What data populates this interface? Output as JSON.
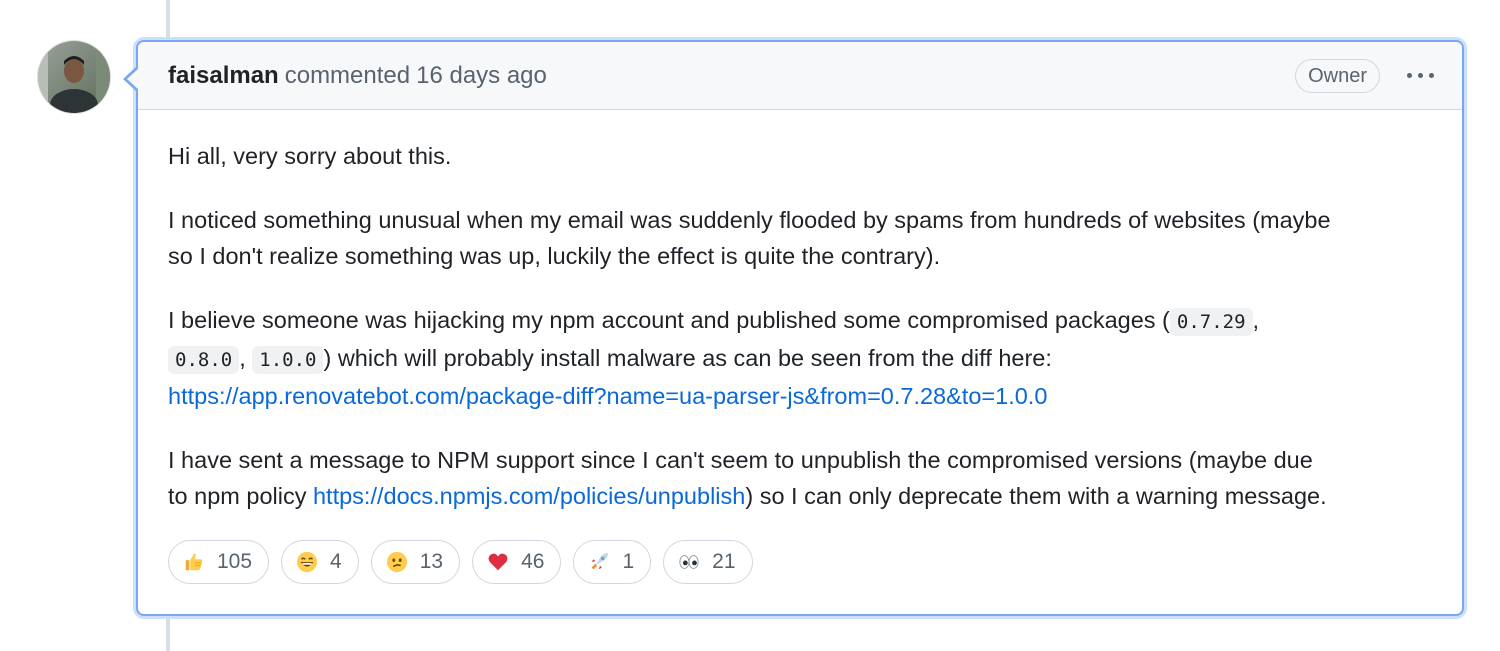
{
  "comment": {
    "author": "faisalman",
    "action": "commented",
    "time": "16 days ago",
    "role_badge": "Owner",
    "options_icon": "kebab-horizontal-icon",
    "paragraphs": {
      "p1": "Hi all, very sorry about this.",
      "p2_line1": "I noticed something unusual when my email was suddenly flooded by spams from hundreds of websites (maybe",
      "p2_line2": "so I don't realize something was up, luckily the effect is quite the contrary).",
      "p3_text1": "I believe someone was hijacking my npm account and published some compromised packages (",
      "p3_code1": "0.7.29",
      "p3_sep1": ",",
      "p3_code2": "0.8.0",
      "p3_sep2": ",",
      "p3_code3": "1.0.0",
      "p3_text2": ") which will probably install malware as can be seen from the diff here:",
      "p3_link": "https://app.renovatebot.com/package-diff?name=ua-parser-js&from=0.7.28&to=1.0.0",
      "p4_text1": "I have sent a message to NPM support since I can't seem to unpublish the compromised versions (maybe due",
      "p4_text2": "to npm policy",
      "p4_link": "https://docs.npmjs.com/policies/unpublish",
      "p4_text3": ") so I can only deprecate them with a warning message."
    },
    "reactions": [
      {
        "icon": "thumbs-up-icon",
        "count": "105"
      },
      {
        "icon": "laugh-icon",
        "count": "4"
      },
      {
        "icon": "confused-icon",
        "count": "13"
      },
      {
        "icon": "heart-icon",
        "count": "46"
      },
      {
        "icon": "rocket-icon",
        "count": "1"
      },
      {
        "icon": "eyes-icon",
        "count": "21"
      }
    ]
  },
  "colors": {
    "link": "#0969da",
    "focus_border": "#7aa7ef",
    "header_bg": "#f6f8fa"
  }
}
